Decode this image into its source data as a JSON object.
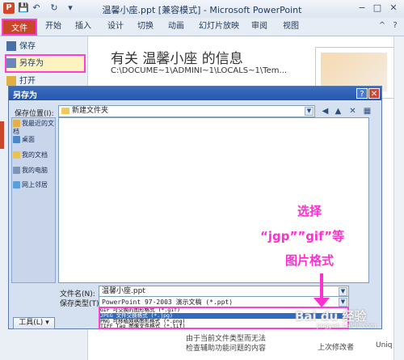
{
  "window": {
    "title": "温馨小座.ppt [兼容模式] - Microsoft PowerPoint",
    "app_badge": "P",
    "minimize_glyph": "−",
    "maximize_glyph": "□",
    "close_glyph": "✕"
  },
  "quick_access": {
    "save_glyph": "💾",
    "undo_glyph": "↶",
    "redo_glyph": "↻",
    "customize_glyph": "▾"
  },
  "ribbon": {
    "file_tab": "文件",
    "tabs": [
      "开始",
      "插入",
      "设计",
      "切换",
      "动画",
      "幻灯片放映",
      "审阅",
      "视图"
    ],
    "help_glyph": "?",
    "collapse_glyph": "^"
  },
  "backstage": {
    "items": [
      "保存",
      "另存为",
      "打开"
    ],
    "info_title": "有关 温馨小座 的信息",
    "info_path": "C:\\DOCUME~1\\ADMINI~1\\LOCALS~1\\Tem...",
    "bottom_text_1": "由于当前文件类型而无法",
    "bottom_text_2": "检查辅助功能问题的内容",
    "bottom_text_3": "上次修改者",
    "bottom_text_4": "Uniq"
  },
  "dialog": {
    "title": "另存为",
    "help_glyph": "?",
    "close_glyph": "✕",
    "save_in_label": "保存位置(I):",
    "save_in_value": "新建文件夹",
    "places": [
      "我最近的文档",
      "桌面",
      "我的文档",
      "我的电脑",
      "网上邻居"
    ],
    "filename_label": "文件名(N):",
    "filename_value": "温馨小座.ppt",
    "filetype_label": "保存类型(T):",
    "filetype_value": "PowerPoint 97-2003 演示文稿 (*.ppt)",
    "filetype_options": [
      "GIF 可交换的图形格式 (*.gif)",
      "JPEG 文件交换格式 (*.jpg)",
      "PNG 可移植网络图形格式 (*.png)",
      "TIFF Tag 图像文件格式 (*.tif)"
    ],
    "tools_label": "工具(L)",
    "toolbar_glyphs": [
      "◀",
      "▲",
      "✕",
      "▦"
    ]
  },
  "annotation": {
    "line1": "选择",
    "line2": "“jgp””gif”等",
    "line3": "图片格式"
  },
  "watermark": {
    "brand": "Bai du 经验",
    "url": "jingyan.baidu.com"
  }
}
